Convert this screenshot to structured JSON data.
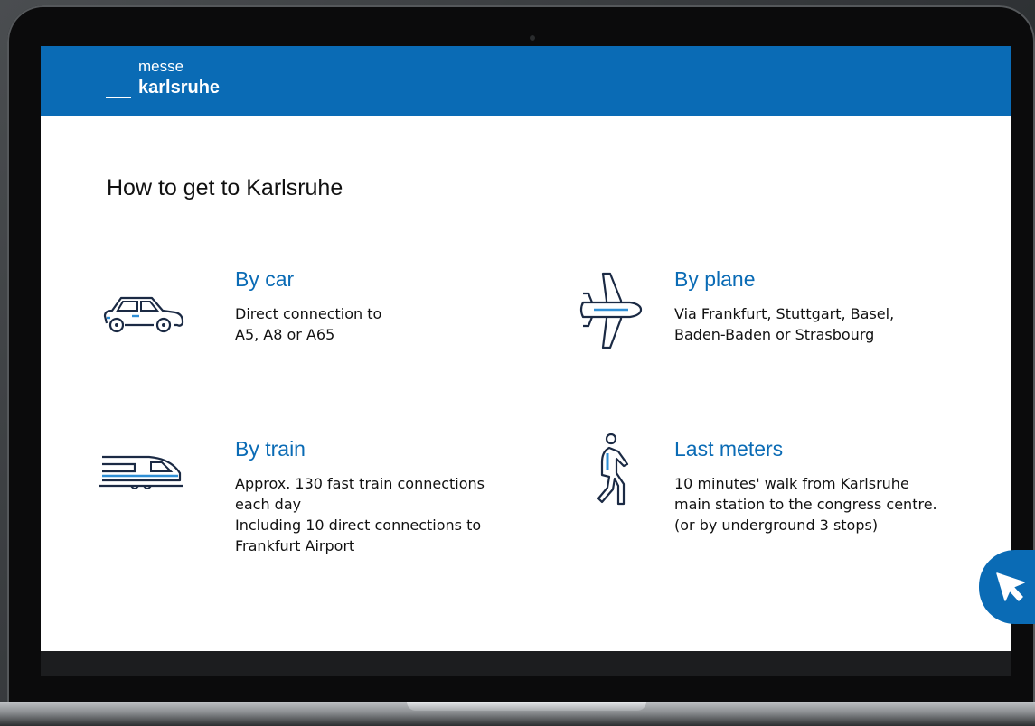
{
  "brand": {
    "line1": "messe",
    "line2": "karlsruhe"
  },
  "page": {
    "title": "How to get to Karlsruhe"
  },
  "options": [
    {
      "title": "By car",
      "icon": "car-icon",
      "lines": [
        "Direct connection to",
        "A5, A8 or A65"
      ]
    },
    {
      "title": "By plane",
      "icon": "plane-icon",
      "lines": [
        "Via Frankfurt, Stuttgart, Basel,",
        "Baden-Baden or Strasbourg"
      ]
    },
    {
      "title": "By train",
      "icon": "train-icon",
      "lines": [
        "Approx. 130 fast train connections",
        "each day",
        "Including 10 direct connections to",
        "Frankfurt Airport"
      ]
    },
    {
      "title": "Last meters",
      "icon": "walking-person-icon",
      "lines": [
        "10 minutes' walk from Karlsruhe",
        "main station to the congress centre.",
        "(or by underground 3 stops)"
      ]
    }
  ],
  "colors": {
    "brand_blue": "#0a6bb5",
    "icon_dark": "#1b2a44",
    "icon_accent": "#2f8fd6"
  },
  "overlay": {
    "icon": "cursor-icon"
  }
}
